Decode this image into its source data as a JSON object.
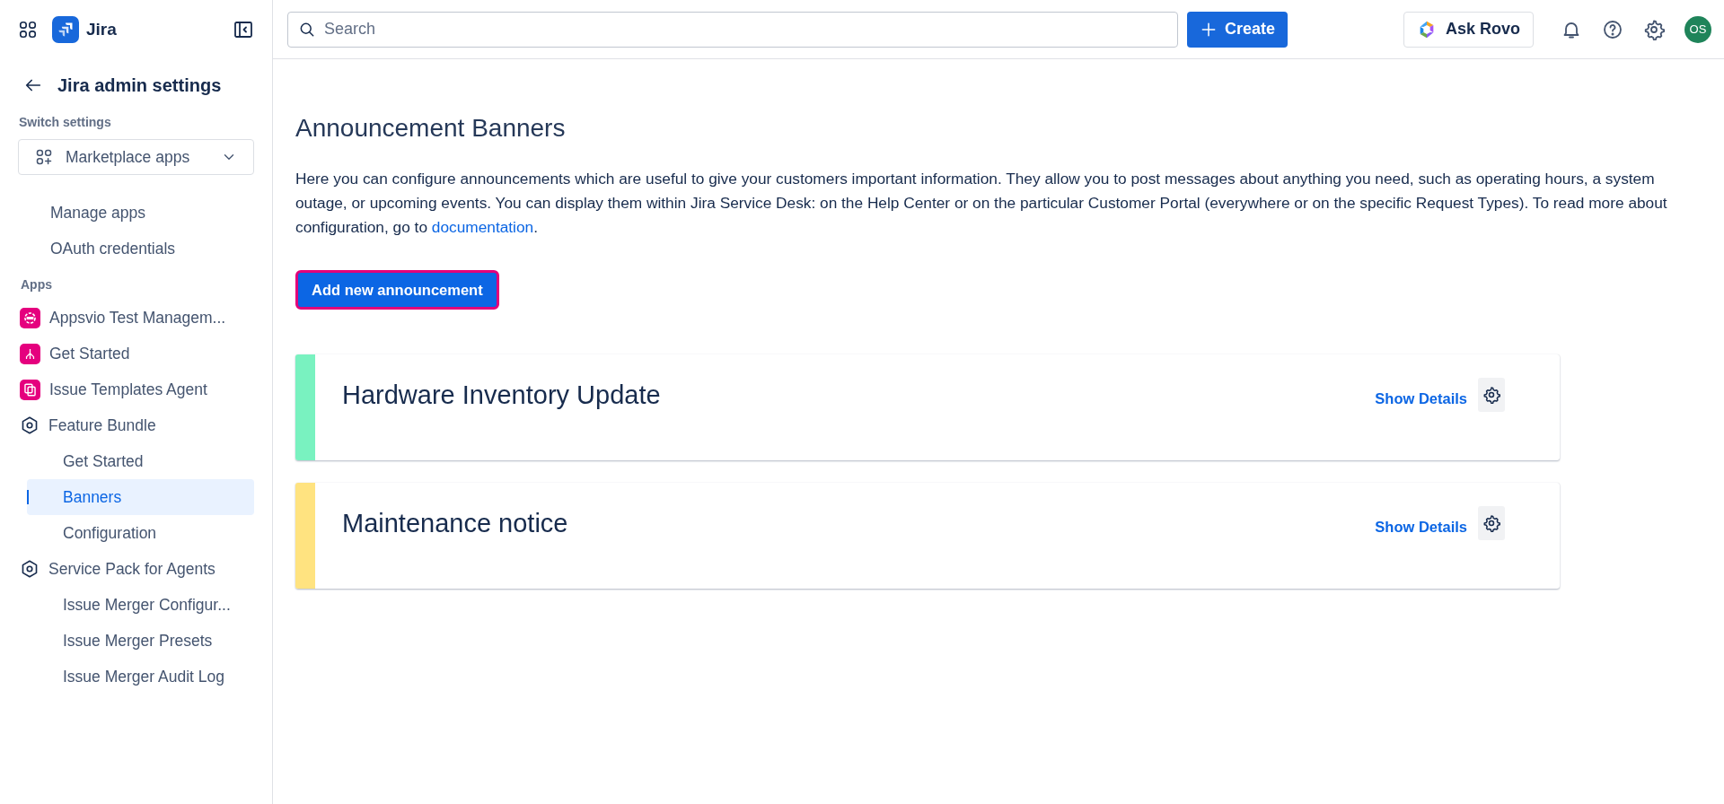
{
  "app": {
    "name": "Jira"
  },
  "topbar": {
    "search": {
      "placeholder": "Search"
    },
    "create_button": "Create",
    "ask_button": "Ask Rovo",
    "avatar": "OS"
  },
  "sidebar": {
    "back_title": "Jira admin settings",
    "switch_label": "Switch settings",
    "switcher": {
      "label": "Marketplace apps"
    },
    "links": [
      {
        "label": "Manage apps",
        "selected": false
      },
      {
        "label": "OAuth credentials",
        "selected": false
      }
    ],
    "apps_label": "Apps",
    "apps": [
      {
        "label": "Appsvio Test Managem...",
        "kind": "app-target"
      },
      {
        "label": "Get Started",
        "kind": "app-branch"
      },
      {
        "label": "Issue Templates Agent",
        "kind": "app-copy"
      },
      {
        "label": "Feature Bundle",
        "kind": "bundle",
        "children": [
          {
            "label": "Get Started",
            "selected": false
          },
          {
            "label": "Banners",
            "selected": true
          },
          {
            "label": "Configuration",
            "selected": false
          }
        ]
      },
      {
        "label": "Service Pack for Agents",
        "kind": "bundle",
        "children": [
          {
            "label": "Issue Merger Configur...",
            "selected": false
          },
          {
            "label": "Issue Merger Presets",
            "selected": false
          },
          {
            "label": "Issue Merger Audit Log",
            "selected": false
          }
        ]
      }
    ]
  },
  "page": {
    "title": "Announcement Banners",
    "intro": "Here you can configure announcements which are useful to give your customers important information. They allow you to post messages about anything you need, such as operating hours, a system outage, or upcoming events. You can display them within Jira Service Desk: on the Help Center or on the particular Customer Portal (everywhere or on the specific Request Types). To read more about configuration, go to",
    "intro_link": "documentation",
    "intro_end": ".",
    "add_button": "Add new announcement",
    "banners": [
      {
        "title": "Hardware Inventory Update",
        "color": "#79f2c0",
        "details": "Show Details"
      },
      {
        "title": "Maintenance notice",
        "color": "#ffe380",
        "details": "Show Details"
      }
    ]
  }
}
